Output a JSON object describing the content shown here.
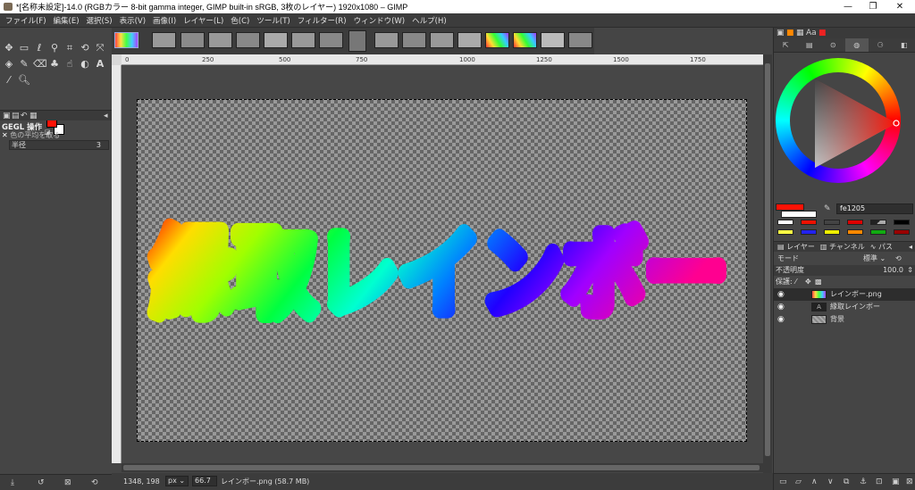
{
  "window": {
    "title": "*[名称未設定]-14.0 (RGBカラー 8-bit gamma integer, GIMP built-in sRGB, 3枚のレイヤー) 1920x1080 – GIMP",
    "minimize": "—",
    "maximize": "❐",
    "close": "✕"
  },
  "menu": [
    "ファイル(F)",
    "編集(E)",
    "選択(S)",
    "表示(V)",
    "画像(I)",
    "レイヤー(L)",
    "色(C)",
    "ツール(T)",
    "フィルター(R)",
    "ウィンドウ(W)",
    "ヘルプ(H)"
  ],
  "tool_options": {
    "title": "GEGL 操作",
    "sample_average": "色の平均を取る",
    "radius_label": "半径",
    "radius_value": "3"
  },
  "ruler": {
    "top_ticks": [
      "0",
      "250",
      "500",
      "750",
      "1000",
      "1250",
      "1500",
      "1750"
    ]
  },
  "canvas": {
    "text_art": "縁取レインボー"
  },
  "status": {
    "coords": "1348, 198",
    "unit": "px",
    "zoom": "66.7",
    "info": "レインボー.png (58.7 MB)"
  },
  "color": {
    "foreground": "#fe1205",
    "background": "#ffffff",
    "hex_value": "fe1205"
  },
  "layers_panel": {
    "tabs": [
      "レイヤー",
      "チャンネル",
      "パス"
    ],
    "mode_label": "モード",
    "mode_value": "標準",
    "opacity_label": "不透明度",
    "opacity_value": "100.0",
    "lock_label": "保護:",
    "layers": [
      {
        "name": "レインボー.png",
        "selected": true
      },
      {
        "name": "縁取レインボー",
        "selected": false
      },
      {
        "name": "背景",
        "selected": false
      }
    ]
  }
}
